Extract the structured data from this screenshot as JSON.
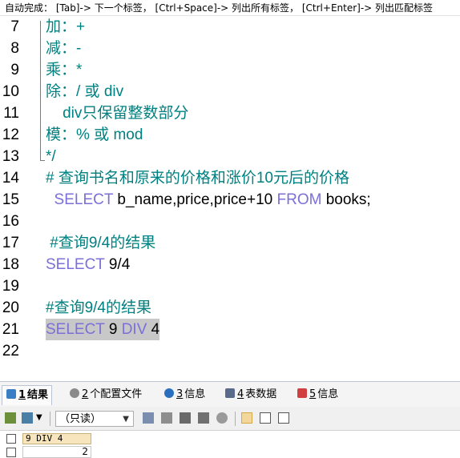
{
  "hint": "自动完成： [Tab]-> 下一个标签， [Ctrl+Space]-> 列出所有标签， [Ctrl+Enter]-> 列出匹配标签",
  "lines": [
    {
      "num": "7",
      "text": "加：+"
    },
    {
      "num": "8",
      "text": "减：-"
    },
    {
      "num": "9",
      "text": "乘：*"
    },
    {
      "num": "10",
      "text": "除：/ 或 div"
    },
    {
      "num": "11",
      "text": "    div只保留整数部分"
    },
    {
      "num": "12",
      "text": "模：% 或 mod"
    },
    {
      "num": "13",
      "text": "*/"
    },
    {
      "num": "14",
      "text": "# 查询书名和原来的价格和涨价10元后的价格"
    },
    {
      "num": "15",
      "kw1": "  SELECT",
      "t1": " b_name,price,price+10 ",
      "kw2": "FROM",
      "t2": " books;"
    },
    {
      "num": "16",
      "text": ""
    },
    {
      "num": "17",
      "text": " #查询9/4的结果"
    },
    {
      "num": "18",
      "kw1": "SELECT",
      "t1": " 9/4"
    },
    {
      "num": "19",
      "text": ""
    },
    {
      "num": "20",
      "text": "#查询9/4的结果"
    },
    {
      "num": "21",
      "kw1": "SELECT",
      "t1": " 9 ",
      "kw2": "DIV",
      "t2": " 4"
    },
    {
      "num": "22",
      "text": ""
    }
  ],
  "tabs": [
    {
      "num": "1",
      "label": "结果",
      "icon_color": "#3a7fc4"
    },
    {
      "num": "2",
      "label": "个配置文件",
      "icon_color": "#8a8a8a"
    },
    {
      "num": "3",
      "label": "信息",
      "icon_color": "#2a6fbf"
    },
    {
      "num": "4",
      "label": "表数据",
      "icon_color": "#5a6a8a"
    },
    {
      "num": "5",
      "label": "信息",
      "icon_color": "#d04040"
    }
  ],
  "toolbar": {
    "mode": "（只读）"
  },
  "result": {
    "column": "9 DIV 4",
    "value": "2"
  },
  "colors": {
    "comment": "#008080",
    "keyword": "#7b6fd8",
    "selection": "#c8c8c8"
  }
}
